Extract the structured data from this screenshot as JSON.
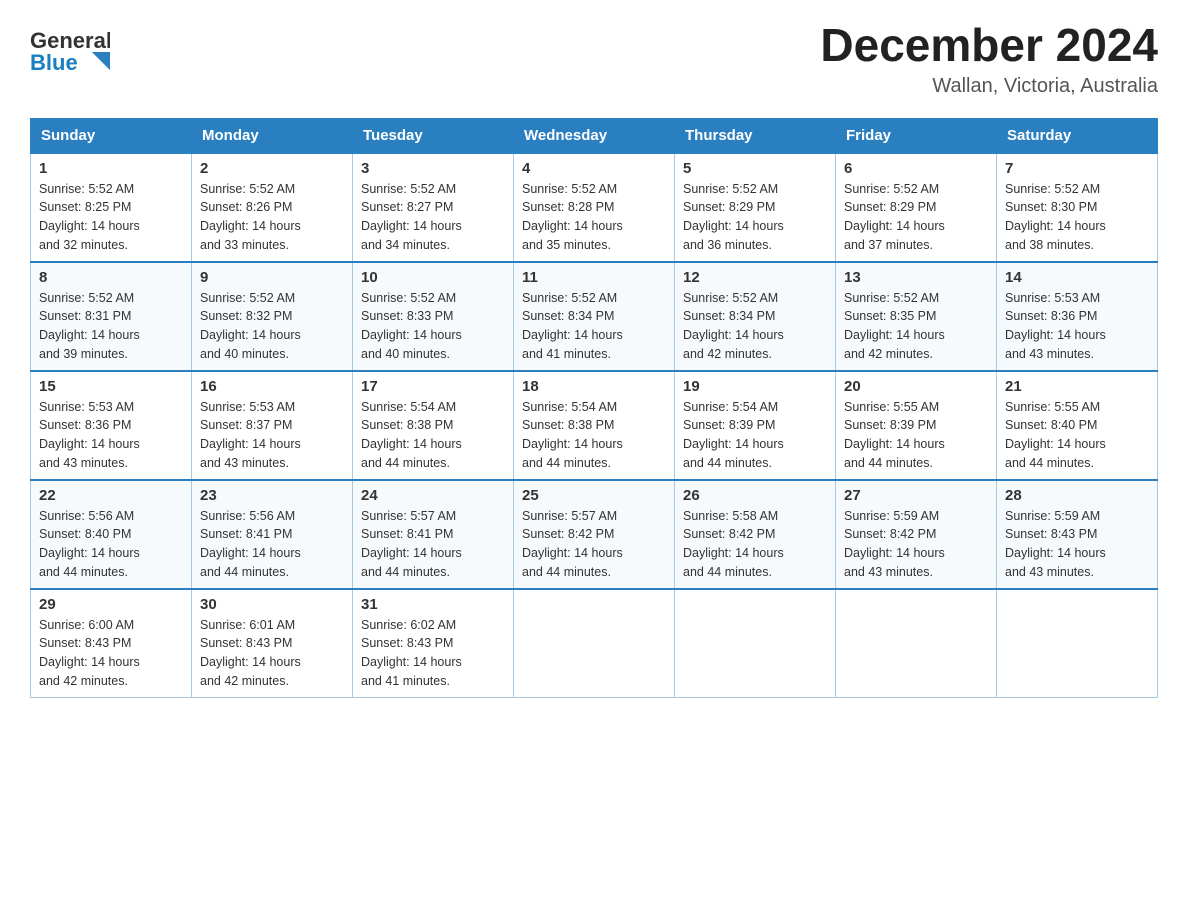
{
  "header": {
    "logo_general": "General",
    "logo_blue": "Blue",
    "month_year": "December 2024",
    "location": "Wallan, Victoria, Australia"
  },
  "days_of_week": [
    "Sunday",
    "Monday",
    "Tuesday",
    "Wednesday",
    "Thursday",
    "Friday",
    "Saturday"
  ],
  "weeks": [
    [
      {
        "day": "1",
        "sunrise": "5:52 AM",
        "sunset": "8:25 PM",
        "daylight": "14 hours and 32 minutes."
      },
      {
        "day": "2",
        "sunrise": "5:52 AM",
        "sunset": "8:26 PM",
        "daylight": "14 hours and 33 minutes."
      },
      {
        "day": "3",
        "sunrise": "5:52 AM",
        "sunset": "8:27 PM",
        "daylight": "14 hours and 34 minutes."
      },
      {
        "day": "4",
        "sunrise": "5:52 AM",
        "sunset": "8:28 PM",
        "daylight": "14 hours and 35 minutes."
      },
      {
        "day": "5",
        "sunrise": "5:52 AM",
        "sunset": "8:29 PM",
        "daylight": "14 hours and 36 minutes."
      },
      {
        "day": "6",
        "sunrise": "5:52 AM",
        "sunset": "8:29 PM",
        "daylight": "14 hours and 37 minutes."
      },
      {
        "day": "7",
        "sunrise": "5:52 AM",
        "sunset": "8:30 PM",
        "daylight": "14 hours and 38 minutes."
      }
    ],
    [
      {
        "day": "8",
        "sunrise": "5:52 AM",
        "sunset": "8:31 PM",
        "daylight": "14 hours and 39 minutes."
      },
      {
        "day": "9",
        "sunrise": "5:52 AM",
        "sunset": "8:32 PM",
        "daylight": "14 hours and 40 minutes."
      },
      {
        "day": "10",
        "sunrise": "5:52 AM",
        "sunset": "8:33 PM",
        "daylight": "14 hours and 40 minutes."
      },
      {
        "day": "11",
        "sunrise": "5:52 AM",
        "sunset": "8:34 PM",
        "daylight": "14 hours and 41 minutes."
      },
      {
        "day": "12",
        "sunrise": "5:52 AM",
        "sunset": "8:34 PM",
        "daylight": "14 hours and 42 minutes."
      },
      {
        "day": "13",
        "sunrise": "5:52 AM",
        "sunset": "8:35 PM",
        "daylight": "14 hours and 42 minutes."
      },
      {
        "day": "14",
        "sunrise": "5:53 AM",
        "sunset": "8:36 PM",
        "daylight": "14 hours and 43 minutes."
      }
    ],
    [
      {
        "day": "15",
        "sunrise": "5:53 AM",
        "sunset": "8:36 PM",
        "daylight": "14 hours and 43 minutes."
      },
      {
        "day": "16",
        "sunrise": "5:53 AM",
        "sunset": "8:37 PM",
        "daylight": "14 hours and 43 minutes."
      },
      {
        "day": "17",
        "sunrise": "5:54 AM",
        "sunset": "8:38 PM",
        "daylight": "14 hours and 44 minutes."
      },
      {
        "day": "18",
        "sunrise": "5:54 AM",
        "sunset": "8:38 PM",
        "daylight": "14 hours and 44 minutes."
      },
      {
        "day": "19",
        "sunrise": "5:54 AM",
        "sunset": "8:39 PM",
        "daylight": "14 hours and 44 minutes."
      },
      {
        "day": "20",
        "sunrise": "5:55 AM",
        "sunset": "8:39 PM",
        "daylight": "14 hours and 44 minutes."
      },
      {
        "day": "21",
        "sunrise": "5:55 AM",
        "sunset": "8:40 PM",
        "daylight": "14 hours and 44 minutes."
      }
    ],
    [
      {
        "day": "22",
        "sunrise": "5:56 AM",
        "sunset": "8:40 PM",
        "daylight": "14 hours and 44 minutes."
      },
      {
        "day": "23",
        "sunrise": "5:56 AM",
        "sunset": "8:41 PM",
        "daylight": "14 hours and 44 minutes."
      },
      {
        "day": "24",
        "sunrise": "5:57 AM",
        "sunset": "8:41 PM",
        "daylight": "14 hours and 44 minutes."
      },
      {
        "day": "25",
        "sunrise": "5:57 AM",
        "sunset": "8:42 PM",
        "daylight": "14 hours and 44 minutes."
      },
      {
        "day": "26",
        "sunrise": "5:58 AM",
        "sunset": "8:42 PM",
        "daylight": "14 hours and 44 minutes."
      },
      {
        "day": "27",
        "sunrise": "5:59 AM",
        "sunset": "8:42 PM",
        "daylight": "14 hours and 43 minutes."
      },
      {
        "day": "28",
        "sunrise": "5:59 AM",
        "sunset": "8:43 PM",
        "daylight": "14 hours and 43 minutes."
      }
    ],
    [
      {
        "day": "29",
        "sunrise": "6:00 AM",
        "sunset": "8:43 PM",
        "daylight": "14 hours and 42 minutes."
      },
      {
        "day": "30",
        "sunrise": "6:01 AM",
        "sunset": "8:43 PM",
        "daylight": "14 hours and 42 minutes."
      },
      {
        "day": "31",
        "sunrise": "6:02 AM",
        "sunset": "8:43 PM",
        "daylight": "14 hours and 41 minutes."
      },
      null,
      null,
      null,
      null
    ]
  ],
  "labels": {
    "sunrise": "Sunrise:",
    "sunset": "Sunset:",
    "daylight": "Daylight:"
  }
}
